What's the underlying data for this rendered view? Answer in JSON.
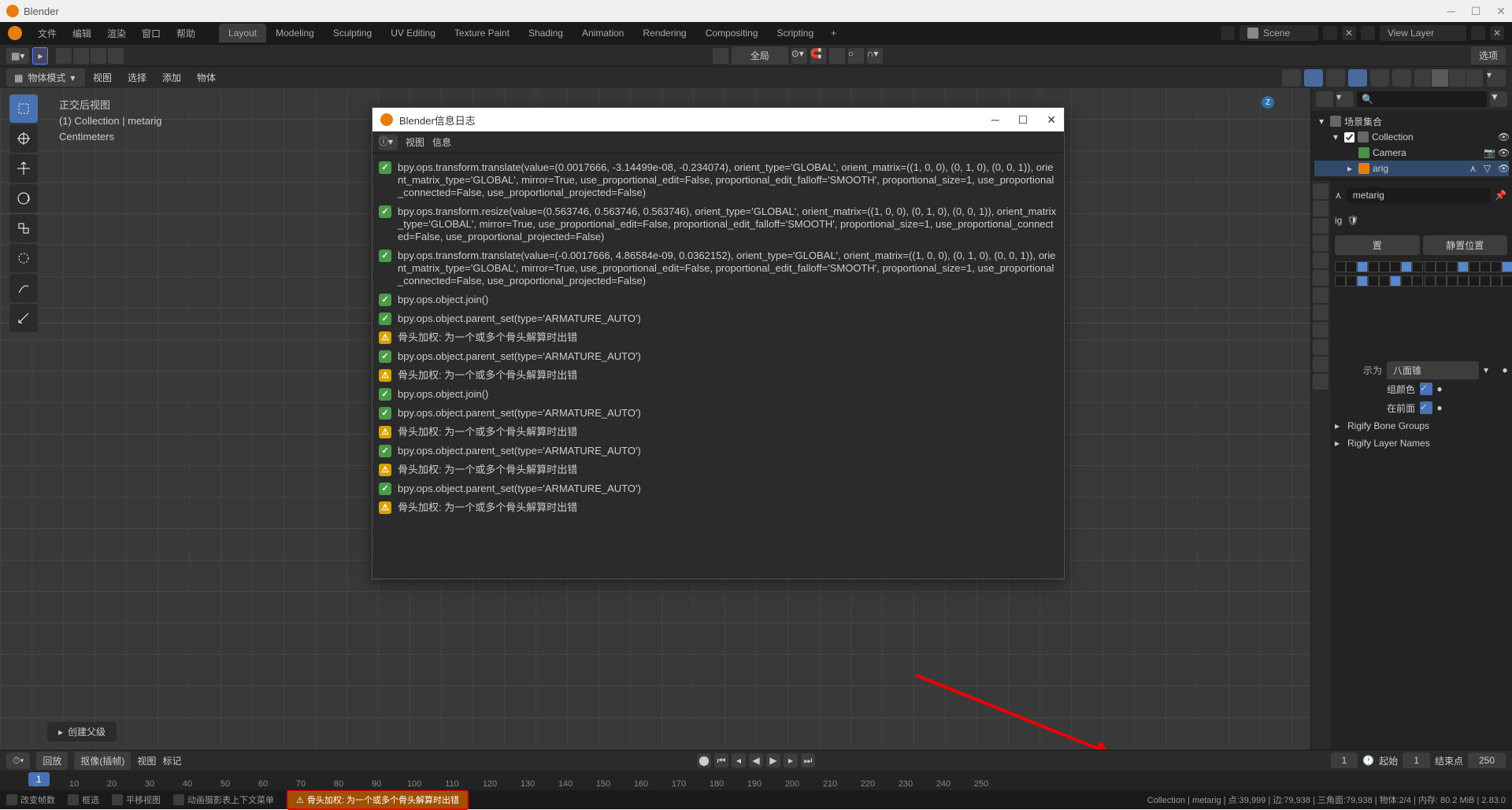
{
  "app": {
    "title": "Blender",
    "info_dialog_title": "Blender信息日志"
  },
  "menubar": {
    "items": [
      "文件",
      "编辑",
      "渲染",
      "窗口",
      "帮助"
    ],
    "tabs": [
      "Layout",
      "Modeling",
      "Sculpting",
      "UV Editing",
      "Texture Paint",
      "Shading",
      "Animation",
      "Rendering",
      "Compositing",
      "Scripting"
    ],
    "active_tab": 0,
    "scene_label": "Scene",
    "viewlayer_label": "View Layer"
  },
  "toolheader": {
    "global": "全局",
    "options": "选项"
  },
  "header2": {
    "mode": "物体模式",
    "menus": [
      "视图",
      "选择",
      "添加",
      "物体"
    ]
  },
  "viewport": {
    "orientation": "正交后视图",
    "collection_info": "(1) Collection | metarig",
    "units": "Centimeters",
    "create_parent": "创建父级",
    "gizmo_z": "Z"
  },
  "outliner": {
    "root": "场景集合",
    "items": [
      {
        "label": "Collection",
        "type": "collection"
      },
      {
        "label": "Camera",
        "type": "camera"
      },
      {
        "label": "arig",
        "type": "armature"
      }
    ]
  },
  "properties": {
    "data_name": "metarig",
    "tab_label": "ig",
    "rest_position": "静置位置",
    "display_label": "示为",
    "display_value": "八面锥",
    "group_color": "组颜色",
    "in_front": "在前面",
    "rigify_bone_groups": "Rigify Bone Groups",
    "rigify_layer_names": "Rigify Layer Names"
  },
  "timeline": {
    "playback": "回放",
    "keying": "抠像(插帧)",
    "menus": [
      "视图",
      "标记"
    ],
    "current_frame": "1",
    "start_label": "起始",
    "start_value": "1",
    "end_label": "结束点",
    "end_value": "250",
    "marks": [
      "1",
      "10",
      "20",
      "30",
      "40",
      "50",
      "60",
      "70",
      "80",
      "90",
      "100",
      "110",
      "120",
      "130",
      "140",
      "150",
      "160",
      "170",
      "180",
      "190",
      "200",
      "210",
      "220",
      "230",
      "240",
      "250"
    ]
  },
  "statusbar": {
    "hints": [
      "改变帧数",
      "框选",
      "平移视图",
      "动画摄影表上下文菜单"
    ],
    "warning": "骨头加权: 为一个或多个骨头解算时出错",
    "stats": "Collection | metarig | 点:39,999 | 边:79,938 | 三角面:79,938 | 物体:2/4 | 内存: 80.2 MiB | 2.83.0"
  },
  "info_log": {
    "menus": [
      "视图",
      "信息"
    ],
    "entries": [
      {
        "type": "ok",
        "text": "bpy.ops.transform.translate(value=(0.0017666, -3.14499e-08, -0.234074), orient_type='GLOBAL', orient_matrix=((1, 0, 0), (0, 1, 0), (0, 0, 1)), orient_matrix_type='GLOBAL', mirror=True, use_proportional_edit=False, proportional_edit_falloff='SMOOTH', proportional_size=1, use_proportional_connected=False, use_proportional_projected=False)"
      },
      {
        "type": "ok",
        "text": "bpy.ops.transform.resize(value=(0.563746, 0.563746, 0.563746), orient_type='GLOBAL', orient_matrix=((1, 0, 0), (0, 1, 0), (0, 0, 1)), orient_matrix_type='GLOBAL', mirror=True, use_proportional_edit=False, proportional_edit_falloff='SMOOTH', proportional_size=1, use_proportional_connected=False, use_proportional_projected=False)"
      },
      {
        "type": "ok",
        "text": "bpy.ops.transform.translate(value=(-0.0017666, 4.86584e-09, 0.0362152), orient_type='GLOBAL', orient_matrix=((1, 0, 0), (0, 1, 0), (0, 0, 1)), orient_matrix_type='GLOBAL', mirror=True, use_proportional_edit=False, proportional_edit_falloff='SMOOTH', proportional_size=1, use_proportional_connected=False, use_proportional_projected=False)"
      },
      {
        "type": "ok",
        "text": "bpy.ops.object.join()"
      },
      {
        "type": "ok",
        "text": "bpy.ops.object.parent_set(type='ARMATURE_AUTO')"
      },
      {
        "type": "warn",
        "text": "骨头加权:  为一个或多个骨头解算时出错"
      },
      {
        "type": "ok",
        "text": "bpy.ops.object.parent_set(type='ARMATURE_AUTO')"
      },
      {
        "type": "warn",
        "text": "骨头加权:  为一个或多个骨头解算时出错"
      },
      {
        "type": "ok",
        "text": "bpy.ops.object.join()"
      },
      {
        "type": "ok",
        "text": "bpy.ops.object.parent_set(type='ARMATURE_AUTO')"
      },
      {
        "type": "warn",
        "text": "骨头加权:  为一个或多个骨头解算时出错"
      },
      {
        "type": "ok",
        "text": "bpy.ops.object.parent_set(type='ARMATURE_AUTO')"
      },
      {
        "type": "warn",
        "text": "骨头加权:  为一个或多个骨头解算时出错"
      },
      {
        "type": "ok",
        "text": "bpy.ops.object.parent_set(type='ARMATURE_AUTO')"
      },
      {
        "type": "warn",
        "text": "骨头加权:  为一个或多个骨头解算时出错"
      }
    ]
  }
}
